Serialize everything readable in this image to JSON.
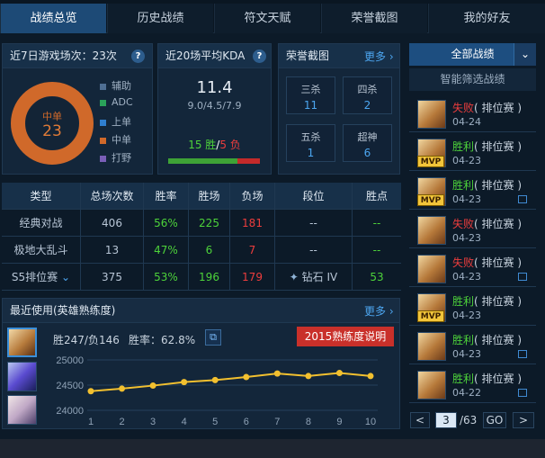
{
  "tabs": [
    "战绩总览",
    "历史战绩",
    "符文天赋",
    "荣誉截图",
    "我的好友"
  ],
  "recent7": {
    "title": "近7日游戏场次：23次",
    "center_label": "中单",
    "center_value": "23",
    "legend": [
      {
        "label": "辅助",
        "color": "#4f6f93"
      },
      {
        "label": "ADC",
        "color": "#2aa25a"
      },
      {
        "label": "上单",
        "color": "#2f7fd0"
      },
      {
        "label": "中单",
        "color": "#d0692a"
      },
      {
        "label": "打野",
        "color": "#7a5fb8"
      }
    ]
  },
  "kda": {
    "title": "近20场平均KDA",
    "value": "11.4",
    "detail": "9.0/4.5/7.9",
    "wins": "15 胜",
    "sep": "/",
    "losses": "5 负",
    "win_ratio": 0.75
  },
  "honor": {
    "title": "荣誉截图",
    "more": "更多",
    "items": [
      {
        "label": "三杀",
        "value": "11"
      },
      {
        "label": "四杀",
        "value": "2"
      },
      {
        "label": "五杀",
        "value": "1"
      },
      {
        "label": "超神",
        "value": "6"
      }
    ]
  },
  "stats_table": {
    "headers": [
      "类型",
      "总场次数",
      "胜率",
      "胜场",
      "负场",
      "段位",
      "胜点"
    ],
    "rows": [
      {
        "type": "经典对战",
        "total": "406",
        "rate": "56%",
        "wins": "225",
        "losses": "181",
        "rank": "--",
        "points": "--"
      },
      {
        "type": "极地大乱斗",
        "total": "13",
        "rate": "47%",
        "wins": "6",
        "losses": "7",
        "rank": "--",
        "points": "--"
      },
      {
        "type": "S5排位赛",
        "total": "375",
        "rate": "53%",
        "wins": "196",
        "losses": "179",
        "rank": "钻石 IV",
        "points": "53"
      }
    ]
  },
  "recent_used": {
    "title": "最近使用(英雄熟练度)",
    "more": "更多",
    "record": "胜247/负146",
    "winrate": "胜率：62.8%",
    "banner": "2015熟练度说明"
  },
  "chart_data": {
    "type": "line",
    "x": [
      1,
      2,
      3,
      4,
      5,
      6,
      7,
      8,
      9,
      10
    ],
    "y": [
      24380,
      24430,
      24490,
      24560,
      24600,
      24660,
      24730,
      24680,
      24740,
      24680
    ],
    "ylim": [
      24000,
      25000
    ],
    "yticks": [
      "25000",
      "24500",
      "24000"
    ],
    "xticks": [
      "1",
      "2",
      "3",
      "4",
      "5",
      "6",
      "7",
      "8",
      "9",
      "10"
    ],
    "color": "#f2c02f"
  },
  "sidebar": {
    "all_button": "全部战绩",
    "filter": "智能筛选战绩"
  },
  "history": [
    {
      "result": "失败",
      "mode": "( 排位赛 )",
      "date": "04-24",
      "mvp": false,
      "img": false
    },
    {
      "result": "胜利",
      "mode": "( 排位赛 )",
      "date": "04-23",
      "mvp": true,
      "img": false
    },
    {
      "result": "胜利",
      "mode": "( 排位赛 )",
      "date": "04-23",
      "mvp": true,
      "img": true
    },
    {
      "result": "失败",
      "mode": "( 排位赛 )",
      "date": "04-23",
      "mvp": false,
      "img": false
    },
    {
      "result": "失败",
      "mode": "( 排位赛 )",
      "date": "04-23",
      "mvp": false,
      "img": true
    },
    {
      "result": "胜利",
      "mode": "( 排位赛 )",
      "date": "04-23",
      "mvp": true,
      "img": false
    },
    {
      "result": "胜利",
      "mode": "( 排位赛 )",
      "date": "04-23",
      "mvp": false,
      "img": true
    },
    {
      "result": "胜利",
      "mode": "( 排位赛 )",
      "date": "04-22",
      "mvp": false,
      "img": true
    }
  ],
  "pager": {
    "prev": "<",
    "page": "3",
    "total": "/63",
    "go": "GO",
    "next": ">"
  }
}
